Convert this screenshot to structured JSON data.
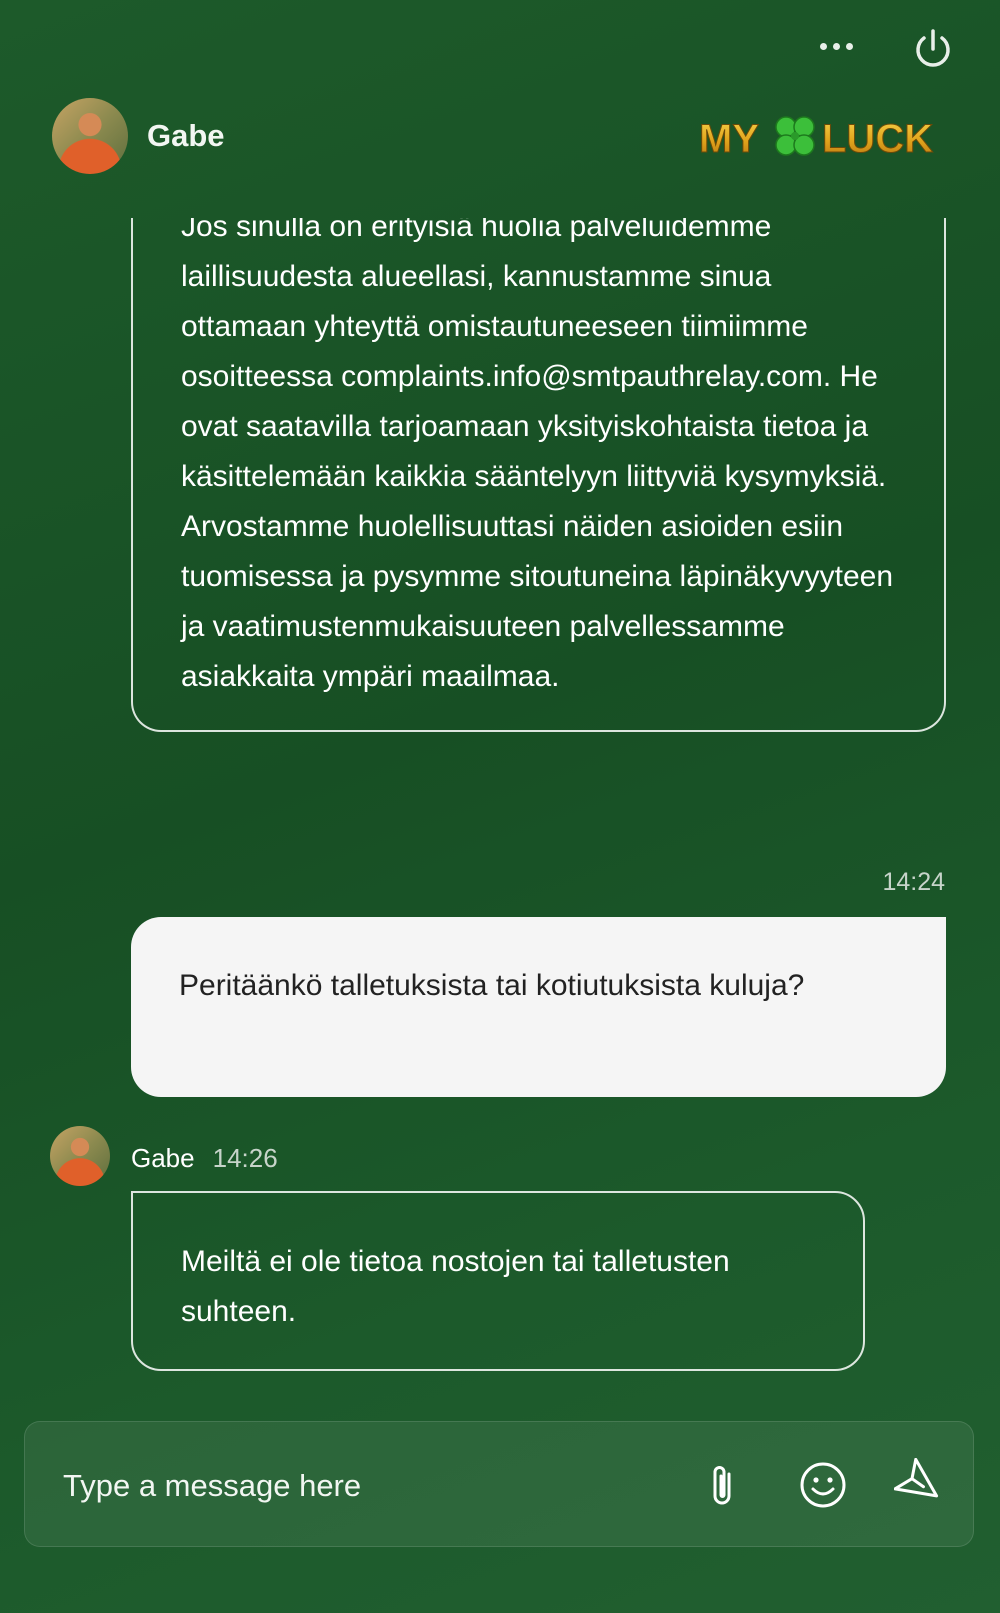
{
  "header": {
    "agent_name": "Gabe",
    "logo_text_left": "MY",
    "logo_text_right": "LUCK"
  },
  "messages": {
    "first_agent_text": "Jos sinulla on erityisiä huolia palveluidemme laillisuudesta alueellasi, kannustamme sinua ottamaan yhteyttä omistautuneeseen tiimiimme osoitteessa complaints.info@smtpauthrelay.com. He ovat saatavilla tarjoamaan yksityiskohtaista tietoa ja käsittelemään kaikkia sääntelyyn liittyviä kysymyksiä. Arvostamme huolellisuuttasi näiden asioiden esiin tuomisessa ja pysymme sitoutuneina läpinäkyvyyteen ja vaatimustenmukaisuuteen palvellessamme asiakkaita ympäri maailmaa.",
    "user_time": "14:24",
    "user_text": "Peritäänkö talletuksista tai kotiutuksista kuluja?",
    "agent_name": "Gabe",
    "agent_time": "14:26",
    "agent_text": "Meiltä ei ole tietoa nostojen tai talletusten suhteen."
  },
  "composer": {
    "placeholder": "Type a message here"
  },
  "icons": {
    "menu": "more-horizontal-icon",
    "power": "power-icon",
    "attach": "paperclip-icon",
    "emoji": "smiley-icon",
    "send": "send-icon"
  },
  "colors": {
    "background": "#1a5428",
    "user_bubble": "#f5f5f5",
    "logo_gold": "#e8b820",
    "logo_clover": "#3cbf3a"
  }
}
